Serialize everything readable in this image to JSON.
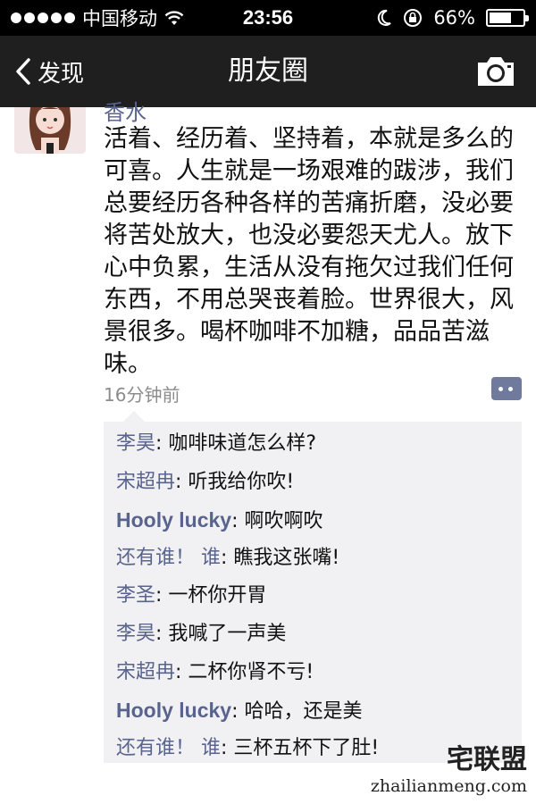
{
  "status_bar": {
    "carrier": "中国移动",
    "time": "23:56",
    "battery": "66%",
    "battery_level": 0.66
  },
  "nav": {
    "back_label": "发现",
    "title": "朋友圈"
  },
  "post": {
    "username": "香水",
    "content": "活着、经历着、坚持着，本就是多么的可喜。人生就是一场艰难的跋涉，我们总要经历各种各样的苦痛折磨，没必要将苦处放大，也没必要怨天尤人。放下心中负累，生活从没有拖欠过我们任何东西，不用总哭丧着脸。世界很大，风景很多。喝杯咖啡不加糖，品品苦滋味。",
    "time": "16分钟前"
  },
  "comments": [
    {
      "name": "李昊",
      "text": ": 咖啡味道怎么样?"
    },
    {
      "name": "宋超冉",
      "text": ": 听我给你吹!"
    },
    {
      "name": "Hooly lucky",
      "text": ": 啊吹啊吹"
    },
    {
      "name": "还有谁！ 谁",
      "text": ": 瞧我这张嘴!"
    },
    {
      "name": "李圣",
      "text": ": 一杯你开胃"
    },
    {
      "name": "李昊",
      "text": ": 我喊了一声美"
    },
    {
      "name": "宋超冉",
      "text": ": 二杯你肾不亏!"
    },
    {
      "name": "Hooly lucky",
      "text": ": 哈哈，还是美"
    },
    {
      "name": "还有谁！ 谁",
      "text": ": 三杯五杯下了肚!"
    }
  ],
  "watermark": {
    "logo": "宅联盟",
    "url": "zhailianmeng.com"
  }
}
